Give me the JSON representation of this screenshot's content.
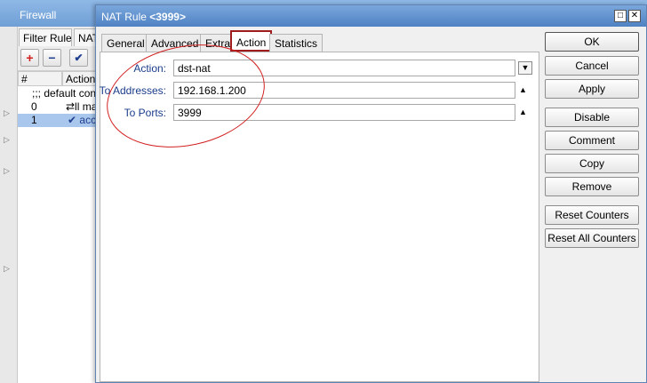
{
  "background_window": {
    "title": "Firewall",
    "tabs": [
      "Filter Rules",
      "NAT"
    ],
    "toolbar": [
      {
        "icon": "plus-icon",
        "glyph": "+",
        "color": "#d22020"
      },
      {
        "icon": "minus-icon",
        "glyph": "−",
        "color": "#1f3f8f"
      },
      {
        "icon": "check-icon",
        "glyph": "✔",
        "color": "#1f3f8f"
      }
    ],
    "columns": [
      "#",
      "Action"
    ],
    "rows": [
      {
        "num": "",
        "action": ";;; default confi"
      },
      {
        "num": "0",
        "action": "⇄ll mas"
      },
      {
        "num": "1",
        "action": "✔ acc",
        "selected": true
      }
    ]
  },
  "dialog": {
    "title_prefix": "NAT Rule",
    "title_id": "<3999>",
    "tabs": [
      {
        "label": "General"
      },
      {
        "label": "Advanced"
      },
      {
        "label": "Extra"
      },
      {
        "label": "Action",
        "active": true
      },
      {
        "label": "Statistics"
      }
    ],
    "fields": {
      "action": {
        "label": "Action:",
        "value": "dst-nat"
      },
      "to_addresses": {
        "label": "To Addresses:",
        "value": "192.168.1.200"
      },
      "to_ports": {
        "label": "To Ports:",
        "value": "3999"
      }
    },
    "buttons": {
      "ok": "OK",
      "cancel": "Cancel",
      "apply": "Apply",
      "disable": "Disable",
      "comment": "Comment",
      "copy": "Copy",
      "remove": "Remove",
      "reset_counters": "Reset Counters",
      "reset_all_counters": "Reset All Counters"
    }
  },
  "colors": {
    "annotation": "#d12020",
    "active_tab_border": "#a01c1c",
    "field_label": "#1a3c8a"
  }
}
